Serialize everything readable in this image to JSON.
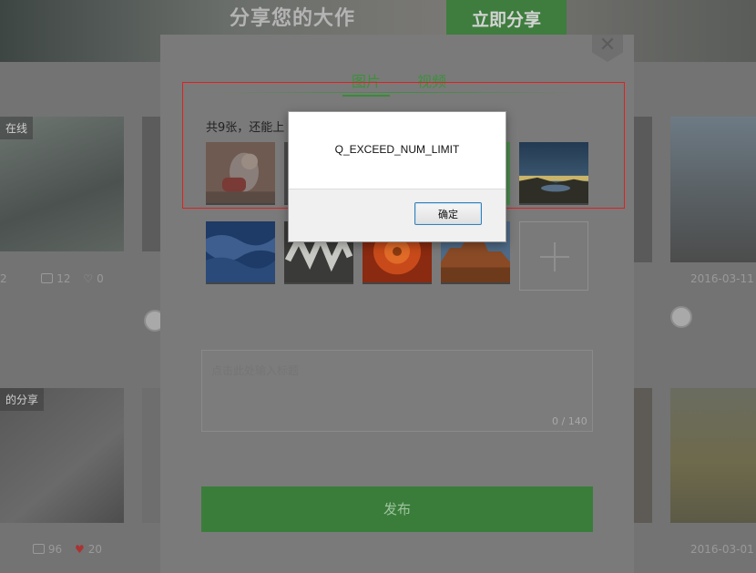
{
  "background": {
    "header_title": "分享您的大作",
    "share_button": "立即分享",
    "cards": [
      {
        "label": "在线"
      },
      {
        "label": ""
      },
      {
        "label": "的分享"
      }
    ],
    "meta_row1_left": {
      "prefix": "2",
      "comments": "12",
      "likes": "0"
    },
    "meta_row2_left": {
      "comments": "96",
      "likes": "20"
    },
    "date_row1_right": "2016-03-11",
    "date_row2_right": "2016-03-01"
  },
  "modal": {
    "close_glyph": "✕",
    "tabs": [
      {
        "label": "图片",
        "active": true
      },
      {
        "label": "视频",
        "active": false
      }
    ],
    "count_text": "共9张，还能上",
    "title_placeholder": "点击此处输入标题",
    "char_count": "0 / 140",
    "publish_label": "发布"
  },
  "dialog": {
    "message": "Q_EXCEED_NUM_LIMIT",
    "ok_label": "确定"
  },
  "colors": {
    "accent_green": "#3a8a3a",
    "highlight_red": "#e02020",
    "dialog_focus_blue": "#3c7fb1"
  }
}
